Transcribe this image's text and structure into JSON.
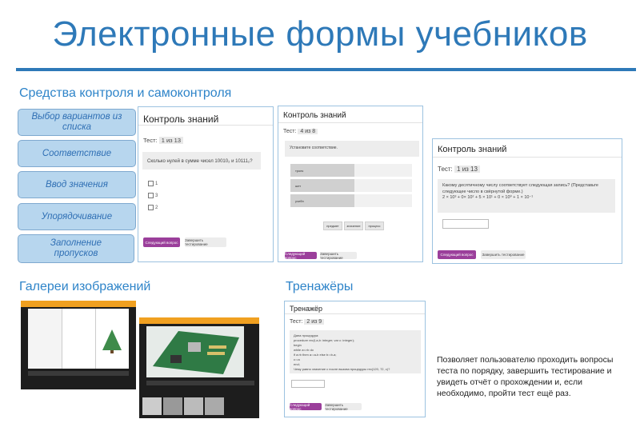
{
  "title": "Электронные формы учебников",
  "sections": {
    "control": "Средства контроля и самоконтроля",
    "galleries": "Галереи изображений",
    "trainers": "Тренажёры"
  },
  "pills": [
    "Выбор вариантов из списка",
    "Соответствие",
    "Ввод значения",
    "Упорядочивание",
    "Заполнение пропусков"
  ],
  "card1": {
    "header": "Контроль знаний",
    "test_label": "Тест:",
    "test_badge": "1 из 13",
    "question": "Сколько нулей в сумме чисел 10010₂ и 10111₂?",
    "options": [
      "1",
      "3",
      "2"
    ],
    "next_btn": "Следующий вопрос",
    "finish_btn": "Завершить тестирование"
  },
  "card2": {
    "header": "Контроль знаний",
    "test_label": "Тест:",
    "test_badge": "4 из 8",
    "question": "Установите соответствие.",
    "rows": [
      "троек",
      "шет",
      "учебн"
    ],
    "chips": [
      "предмет",
      "значение",
      "процесс"
    ],
    "next_btn": "Следующий вопрос",
    "finish_btn": "Завершить тестирование"
  },
  "card3": {
    "header": "Контроль знаний",
    "test_label": "Тест:",
    "test_badge": "1 из 13",
    "question": "Какому десятичному числу соответствует следующая запись? (Представьте следующее число в свёрнутой форме.)",
    "formula": "2 × 10³ + 0× 10² + 5 × 10¹ + 0 × 10⁰ + 1 × 10⁻¹",
    "next_btn": "Следующий вопрос",
    "finish_btn": "Завершить тестирование"
  },
  "card4": {
    "header": "Тренажёр",
    "test_label": "Тест:",
    "test_badge": "2 из 9",
    "code": [
      "Дана процедура:",
      "procedure rec(I,a,b: integer; var c: integer);",
      "begin",
      "while a<>b do",
      "if a>b then a:=a-b else b:=b-a;",
      "c:=a",
      "end;",
      "Чему равно значение c после вызова процедуры rec(120, 72, c)?"
    ],
    "next_btn": "Следующий вопрос",
    "finish_btn": "Завершить тестирование"
  },
  "description": "Позволяет пользователю проходить вопросы теста по порядку, завершить тестирование и увидеть отчёт о прохождении и, если необходимо, пройти тест ещё раз.",
  "colors": {
    "accent": "#2e79b8",
    "pill_bg": "#b7d6ee",
    "primary_btn": "#9b3f9b",
    "gallery_bar": "#f0a020"
  }
}
